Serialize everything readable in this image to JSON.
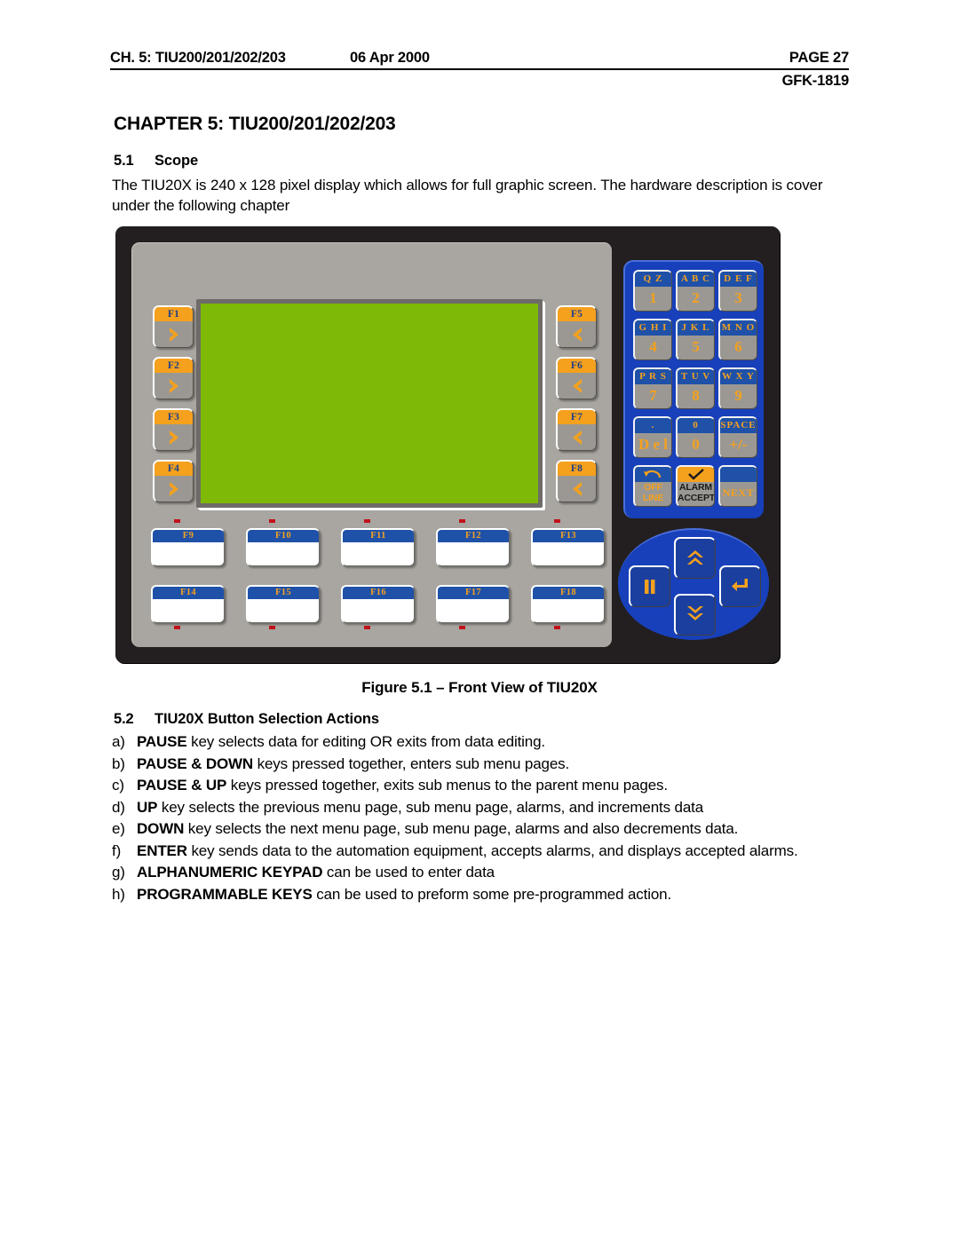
{
  "header": {
    "chapter_ref": "CH. 5: TIU200/201/202/203",
    "date": "06 Apr 2000",
    "page": "PAGE 27",
    "doc_id": "GFK-1819"
  },
  "chapter_title": "CHAPTER 5: TIU200/201/202/203",
  "sections": {
    "scope": {
      "number": "5.1",
      "title": "Scope",
      "body": "The TIU20X is 240 x 128 pixel display which allows for full graphic screen. The hardware description is cover under the following chapter"
    },
    "button_actions": {
      "number": "5.2",
      "title": "TIU20X Button Selection Actions"
    }
  },
  "figure": {
    "caption": "Figure 5.1 – Front View of TIU20X",
    "side_keys_left": [
      {
        "label": "F1",
        "icon": "chevron-right-icon"
      },
      {
        "label": "F2",
        "icon": "chevron-right-icon"
      },
      {
        "label": "F3",
        "icon": "chevron-right-icon"
      },
      {
        "label": "F4",
        "icon": "chevron-right-icon"
      }
    ],
    "side_keys_right": [
      {
        "label": "F5",
        "icon": "chevron-left-icon"
      },
      {
        "label": "F6",
        "icon": "chevron-left-icon"
      },
      {
        "label": "F7",
        "icon": "chevron-left-icon"
      },
      {
        "label": "F8",
        "icon": "chevron-left-icon"
      }
    ],
    "programmable_keys_row1": [
      {
        "label": "F9"
      },
      {
        "label": "F10"
      },
      {
        "label": "F11"
      },
      {
        "label": "F12"
      },
      {
        "label": "F13"
      }
    ],
    "programmable_keys_row2": [
      {
        "label": "F14"
      },
      {
        "label": "F15"
      },
      {
        "label": "F16"
      },
      {
        "label": "F17"
      },
      {
        "label": "F18"
      }
    ],
    "keypad": [
      {
        "top": "Q Z",
        "bottom": "1"
      },
      {
        "top": "A B C",
        "bottom": "2"
      },
      {
        "top": "D E F",
        "bottom": "3"
      },
      {
        "top": "G H I",
        "bottom": "4"
      },
      {
        "top": "J K L",
        "bottom": "5"
      },
      {
        "top": "M N O",
        "bottom": "6"
      },
      {
        "top": "P R S",
        "bottom": "7"
      },
      {
        "top": "T U V",
        "bottom": "8"
      },
      {
        "top": "W X Y",
        "bottom": "9"
      },
      {
        "top": ".",
        "bottom": "D e l"
      },
      {
        "top": "0",
        "bottom": "0"
      },
      {
        "top": "SPACE",
        "bottom": "+/-"
      }
    ],
    "keypad_bottom_row": [
      {
        "label": "OFF\nLINE",
        "line1": "OFF",
        "line2": "LINE",
        "icon": "offline-arrow-icon"
      },
      {
        "label": "ALARM\nACCEPT",
        "line1": "ALARM",
        "line2": "ACCEPT",
        "icon": "checkmark-icon"
      },
      {
        "label": "NEXT",
        "line1": "NEXT",
        "line2": "",
        "icon": "none"
      }
    ],
    "nav_keys": [
      {
        "name": "pause",
        "icon": "pause-icon"
      },
      {
        "name": "up",
        "icon": "double-chevron-up-icon"
      },
      {
        "name": "down",
        "icon": "double-chevron-down-icon"
      },
      {
        "name": "enter",
        "icon": "enter-arrow-icon"
      }
    ],
    "colors": {
      "bezel": "#231f20",
      "panel": "#a9a6a1",
      "lcd": "#7db906",
      "keypad_blue": "#1740ba",
      "accent_orange": "#f5a11d",
      "cap_blue": "#1f51a8",
      "led_red": "#c1121b"
    }
  },
  "actions": [
    {
      "marker": "a)",
      "bold": "PAUSE",
      "rest": " key selects data for editing OR exits from data editing."
    },
    {
      "marker": "b)",
      "bold": "PAUSE & DOWN",
      "rest": " keys pressed together, enters sub menu pages."
    },
    {
      "marker": "c)",
      "bold": "PAUSE & UP",
      "rest": " keys pressed together, exits sub menus to the parent menu pages."
    },
    {
      "marker": "d)",
      "bold": "UP",
      "rest": " key selects the previous menu page, sub menu page, alarms, and increments data"
    },
    {
      "marker": "e)",
      "bold": "DOWN",
      "rest": " key selects the next menu page, sub menu page, alarms and also decrements data."
    },
    {
      "marker": "f)",
      "bold": "ENTER",
      "rest": " key sends data to the automation equipment, accepts alarms, and displays accepted alarms."
    },
    {
      "marker": "g)",
      "bold": "ALPHANUMERIC KEYPAD",
      "rest": " can be used to enter data"
    },
    {
      "marker": "h)",
      "bold": "PROGRAMMABLE KEYS",
      "rest": " can be used to preform some pre-programmed action."
    }
  ]
}
